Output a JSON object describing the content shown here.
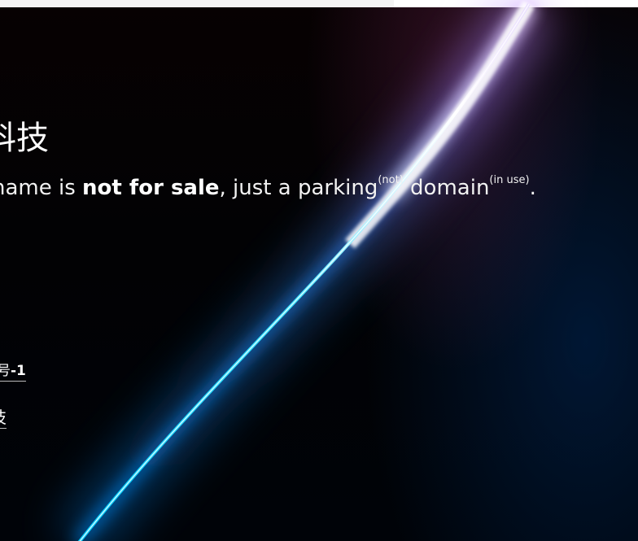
{
  "page": {
    "title_fragment": "科技",
    "tagline": {
      "start": "name is ",
      "not_for_sale": "not for sale",
      "middle": ", just a parking",
      "parking_note": "(not)",
      "domain_word": " domain",
      "domain_note": "(in use)",
      "end": "."
    },
    "links": {
      "record_prefix": "号",
      "record_number": "-1",
      "company_fragment": "技"
    }
  },
  "colors": {
    "background": "#000000",
    "text": "#ffffff",
    "glow_cyan": "#00d8ff",
    "glow_violet": "#b98cff"
  }
}
